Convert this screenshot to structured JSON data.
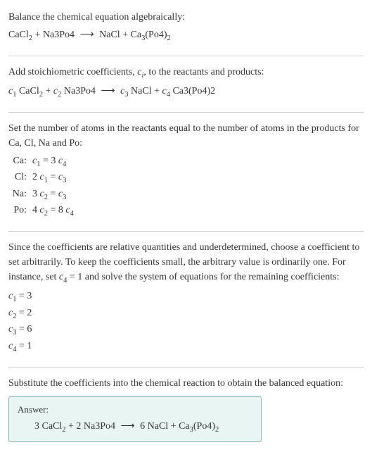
{
  "s1": {
    "intro": "Balance the chemical equation algebraically:",
    "r1": "CaCl",
    "r1s": "2",
    "plus1": " + ",
    "r2": "Na3Po4",
    "arrow": "⟶",
    "p1": "NaCl + Ca",
    "p1s": "3",
    "p2": "(Po4)",
    "p2s": "2"
  },
  "s2": {
    "intro1": "Add stoichiometric coefficients, ",
    "ci": "c",
    "cis": "i",
    "intro2": ", to the reactants and products:",
    "c1": "c",
    "c1s": "1",
    "sp1": " CaCl",
    "sp1s": "2",
    "plus1": " + ",
    "c2": "c",
    "c2s": "2",
    "sp2": " Na3Po4",
    "arrow": "⟶",
    "c3": "c",
    "c3s": "3",
    "sp3": " NaCl + ",
    "c4": "c",
    "c4s": "4",
    "sp4": " Ca3(Po4)2"
  },
  "s3": {
    "intro": "Set the number of atoms in the reactants equal to the number of atoms in the products for Ca, Cl, Na and Po:",
    "rows": {
      "ca": {
        "label": "Ca:",
        "lhs_c": "c",
        "lhs_s": "1",
        "mid": " = 3 ",
        "rhs_c": "c",
        "rhs_s": "4"
      },
      "cl": {
        "label": "Cl:",
        "lhs_pre": "2 ",
        "lhs_c": "c",
        "lhs_s": "1",
        "mid": " = ",
        "rhs_c": "c",
        "rhs_s": "3"
      },
      "na": {
        "label": "Na:",
        "lhs_pre": "3 ",
        "lhs_c": "c",
        "lhs_s": "2",
        "mid": " = ",
        "rhs_c": "c",
        "rhs_s": "3"
      },
      "po": {
        "label": "Po:",
        "lhs_pre": "4 ",
        "lhs_c": "c",
        "lhs_s": "2",
        "mid": " = 8 ",
        "rhs_c": "c",
        "rhs_s": "4"
      }
    }
  },
  "s4": {
    "intro1": "Since the coefficients are relative quantities and underdetermined, choose a coefficient to set arbitrarily. To keep the coefficients small, the arbitrary value is ordinarily one. For instance, set ",
    "setc": "c",
    "setcs": "4",
    "setval": " = 1",
    "intro2": " and solve the system of equations for the remaining coefficients:",
    "coeffs": {
      "c1": {
        "c": "c",
        "s": "1",
        "v": " = 3"
      },
      "c2": {
        "c": "c",
        "s": "2",
        "v": " = 2"
      },
      "c3": {
        "c": "c",
        "s": "3",
        "v": " = 6"
      },
      "c4": {
        "c": "c",
        "s": "4",
        "v": " = 1"
      }
    }
  },
  "s5": {
    "intro": "Substitute the coefficients into the chemical reaction to obtain the balanced equation:",
    "answer_label": "Answer:",
    "eq": {
      "r1pre": "3 CaCl",
      "r1s": "2",
      "plus1": " + 2 Na3Po4",
      "arrow": "⟶",
      "p1": "6 NaCl + Ca",
      "p1s": "3",
      "p2": "(Po4)",
      "p2s": "2"
    }
  }
}
